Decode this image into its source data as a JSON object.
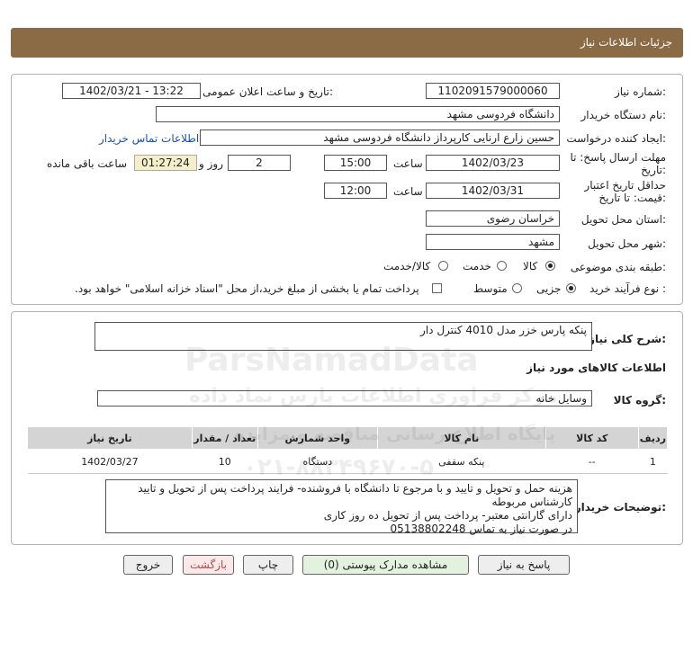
{
  "header": {
    "title": "جزئیات اطلاعات نیاز"
  },
  "form": {
    "need_number_label": "شماره نیاز:",
    "need_number": "1102091579000060",
    "announce_label": "تاریخ و ساعت اعلان عمومی:",
    "announce_value": "1402/03/21 - 13:22",
    "buyer_label": "نام دستگاه خریدار:",
    "buyer_value": "دانشگاه فردوسی مشهد",
    "creator_label": "ایجاد کننده درخواست:",
    "creator_value": "حسین زارع ارنایی کارپرداز دانشگاه فردوسی مشهد",
    "contact_link": "اطلاعات تماس خریدار",
    "deadline_label_1": "مهلت ارسال پاسخ: تا",
    "deadline_label_2": "تاریخ:",
    "deadline_date": "1402/03/23",
    "time_label": "ساعت",
    "deadline_time": "15:00",
    "days_value": "2",
    "days_label": "روز و",
    "remaining_time": "01:27:24",
    "remaining_label": "ساعت باقی مانده",
    "validity_label_1": "حداقل تاریخ اعتبار",
    "validity_label_2": "قیمت: تا تاریخ:",
    "validity_date": "1402/03/31",
    "validity_time": "12:00",
    "province_label": "استان محل تحویل:",
    "province_value": "خراسان رضوی",
    "city_label": "شهر محل تحویل:",
    "city_value": "مشهد",
    "category_label": "طبقه بندی موضوعی:",
    "category_options": [
      "کالا",
      "خدمت",
      "کالا/خدمت"
    ],
    "process_label": "نوع فرآیند خرید :",
    "process_options": [
      "جزیی",
      "متوسط"
    ],
    "treasury_text": "پرداخت تمام یا بخشی از مبلغ خرید،از محل \"اسناد خزانه اسلامی\" خواهد بود."
  },
  "details": {
    "summary_label": "شرح کلی نیاز:",
    "summary_value": "پنکه پارس خزر مدل 4010 کنترل دار",
    "goods_info_title": "اطلاعات کالاهای مورد نیاز",
    "goods_group_label": "گروه کالا:",
    "goods_group_value": "وسایل خانه",
    "table": {
      "headers": [
        "ردیف",
        "کد کالا",
        "نام کالا",
        "واحد شمارش",
        "تعداد / مقدار",
        "تاریخ نیاز"
      ],
      "rows": [
        [
          "1",
          "--",
          "پنکه سقفی",
          "دستگاه",
          "10",
          "1402/03/27"
        ]
      ]
    },
    "buyer_notes_label": "توضیحات خریدار:",
    "buyer_notes": [
      "هزینه حمل و تحویل و تایید و با مرجوع تا دانشگاه با فروشنده- فرایند پرداخت پس از تحویل و تایید",
      "کارشناس مربوطه",
      "دارای گارانتی معتبر- پرداخت پس از تحویل ده روز کاری",
      "در صورت نیاز به تماس 05138802248"
    ]
  },
  "buttons": {
    "reply": "پاسخ به نیاز",
    "attachments": "مشاهده مدارک پیوستی (0)",
    "print": "چاپ",
    "back": "بازگشت",
    "exit": "خروج"
  },
  "watermark": {
    "brand": "ParsNamadData",
    "line1": "مرکز فراوری اطلاعات پارس نماد داده",
    "line2": "پایگاه اطلاع رسانی مناقصه و مزایده",
    "phone": "۰۲۱-۸۸۳۴۹۶۷۰-۵"
  },
  "colors": {
    "header_bg": "#8b6b45",
    "link": "#1a4fb5",
    "remaining_bg": "#f4efc9"
  }
}
